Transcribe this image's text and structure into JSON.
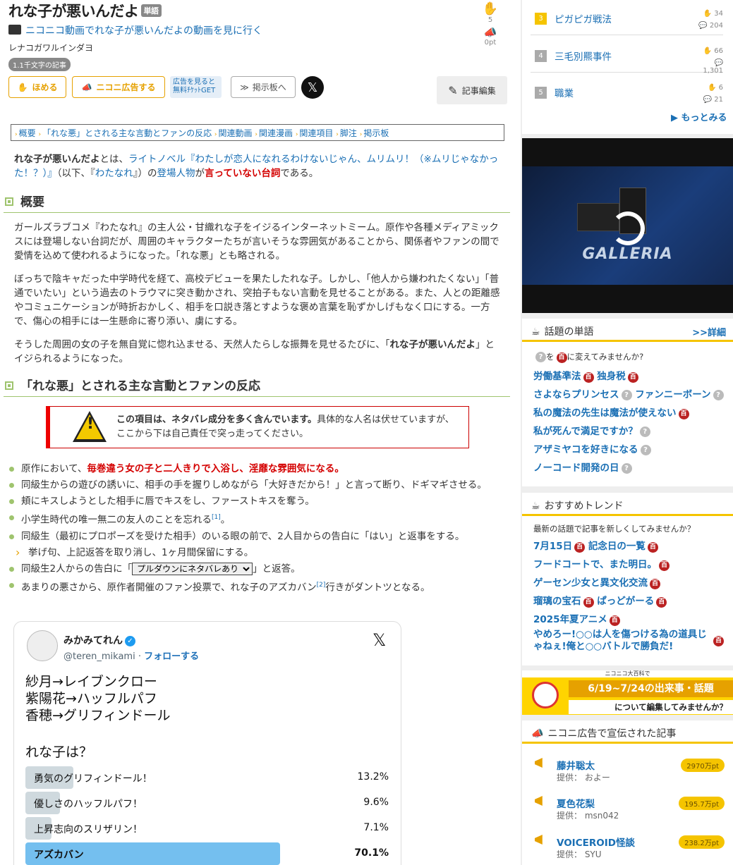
{
  "article": {
    "title": "れな子が悪いんだよ",
    "type_tag": "単語",
    "video_link": "ニコニコ動画でれな子が悪いんだよの動画を見に行く",
    "reading": "レナコガワルインダヨ",
    "char_count": "1.1千文字の記事",
    "claps": "5",
    "pt": "0pt"
  },
  "buttons": {
    "homeru": "ほめる",
    "ad": "ニコニ広告する",
    "ticket": "広告を見ると無料ﾁｹｯﾄGET",
    "bbs": "掲示板へ",
    "x": "𝕏",
    "edit": "記事編集"
  },
  "toc": [
    "概要",
    "「れな悪」とされる主な言動とファンの反応",
    "関連動画",
    "関連漫画",
    "関連項目",
    "脚注",
    "掲示板"
  ],
  "intro": {
    "a": "れな子が悪いんだよ",
    "b": "とは、",
    "c": "ライトノベル『わたしが恋人になれるわけないじゃん、ムリムリ！（※ムリじゃなかった！？）』",
    "d": "（以下、『",
    "e": "わたなれ",
    "f": "』）の",
    "g": "登場人物",
    "h": "が",
    "i": "言っていない台詞",
    "j": "である。"
  },
  "section1": {
    "title": "概要",
    "p1": "ガールズラブコメ『わたなれ』の主人公・甘織れな子をイジるインターネットミーム。原作や各種メディアミックスには登場しない台詞だが、周囲のキャラクターたちが言いそうな雰囲気があることから、関係者やファンの間で愛情を込めて使われるようになった。「れな悪」とも略される。",
    "p2": "ぼっちで陰キャだった中学時代を経て、高校デビューを果たしたれな子。しかし、「他人から嫌われたくない」「普通でいたい」という過去のトラウマに突き動かされ、突拍子もない言動を見せることがある。また、人との距離感やコミュニケーションが時折おかしく、相手を口説き落とすような褒め言葉を恥ずかしげもなく口にする。一方で、傷心の相手には一生懸命に寄り添い、虜にする。",
    "p3a": "そうした周囲の女の子を無自覚に惚れ込ませる、天然人たらしな振舞を見せるたびに、「",
    "p3b": "れな子が悪いんだよ",
    "p3c": "」とイジられるようになった。"
  },
  "section2": {
    "title": "「れな悪」とされる主な言動とファンの反応",
    "warn_bold": "この項目は、ネタバレ成分を多く含んでいます。",
    "warn_rest": "具体的な人名は伏せていますが、ここから下は自己責任で突っ走ってください。",
    "items": [
      {
        "a": "原作において、",
        "b": "毎巻違う女の子と二人きりで入浴し、淫靡な雰囲気になる。"
      },
      {
        "a": "同級生からの遊びの誘いに、相手の手を握りしめながら「大好きだから！」と言って断り、ドギマギさせる。"
      },
      {
        "a": "頬にキスしようとした相手に唇でキスをし、ファーストキスを奪う。"
      },
      {
        "a": "小学生時代の唯一無二の友人のことを忘れる",
        "sup": "[1]",
        "b": "。"
      },
      {
        "a": "同級生（最初にプロポーズを受けた相手）のいる眼の前で、2人目からの告白に「はい」と返事をする。"
      },
      {
        "a": "挙げ句、上記返答を取り消し、1ヶ月間保留にする。"
      },
      {
        "a": "同級生2人からの告白に「",
        "sel": "プルダウンにネタバレあり",
        "b": "」と返答。"
      },
      {
        "a": "あまりの悪さから、原作者開催のファン投票で、れな子のアズカバン",
        "sup": "[2]",
        "b": "行きがダントツとなる。"
      }
    ]
  },
  "tweet": {
    "name": "みかみてれん",
    "handle": "@teren_mikami · ",
    "follow": "フォローする",
    "body": "紗月→レイブンクロー\n紫陽花→ハッフルパフ\n香穂→グリフィンドール",
    "question": "れな子は？",
    "poll": [
      {
        "label": "勇気のグリフィンドール！",
        "pct": "13.2%",
        "value": 13.2
      },
      {
        "label": "優しさのハッフルパフ！",
        "pct": "9.6%",
        "value": 9.6
      },
      {
        "label": "上昇志向のスリザリン！",
        "pct": "7.1%",
        "value": 7.1
      },
      {
        "label": "アズカバン",
        "pct": "70.1%",
        "value": 70.1
      }
    ]
  },
  "sidebar": {
    "ranking": [
      {
        "num": "3",
        "title": "ピガピガ戦法",
        "claps": "34",
        "comments": "204"
      },
      {
        "num": "4",
        "title": "三毛別羆事件",
        "claps": "66",
        "comments": "1,301"
      },
      {
        "num": "5",
        "title": "職業",
        "claps": "6",
        "comments": "21"
      }
    ],
    "more": "▶ もっとみる",
    "video_logo": "GALLERIA",
    "topic": {
      "title": "話題の単語",
      "detail": ">>詳細",
      "hint_a": "を",
      "hint_b": "に変えてみませんか?",
      "rows": [
        [
          "労働基準法",
          "独身税"
        ],
        [
          "さよならプリンセス",
          "ファンニーボーン"
        ],
        [
          "私の魔法の先生は魔法が使えない"
        ],
        [
          "私が死んで満足ですか？"
        ],
        [
          "アザミヤコを好きになる"
        ],
        [
          "ノーコード開発の日"
        ]
      ]
    },
    "trend": {
      "title": "おすすめトレンド",
      "hint": "最新の話題で記事を新しくしてみませんか？",
      "rows": [
        [
          "7月15日",
          "記念日の一覧"
        ],
        [
          "フードコートで、また明日。"
        ],
        [
          "ゲーセン少女と異文化交流"
        ],
        [
          "瑠璃の宝石",
          "ぱっどがーる"
        ],
        [
          "2025年夏アニメ"
        ],
        [
          "やめろー!○○は人を傷つける為の道具じゃねぇ!俺と○○バトルで勝負だ!"
        ]
      ]
    },
    "banner": {
      "top": "ニコニコ大百科で",
      "main": "6/19~7/24の出来事・話題",
      "sub": "について編集してみませんか？"
    },
    "ads": {
      "title": "ニコニ広告で宣伝された記事",
      "items": [
        {
          "title": "藤井聡太",
          "by": "提供： およー",
          "pt": "2970万pt"
        },
        {
          "title": "夏色花梨",
          "by": "提供： msn042",
          "pt": "195.7万pt"
        },
        {
          "title": "VOICEROID怪談",
          "by": "提供： SYU",
          "pt": "238.2万pt"
        }
      ]
    },
    "icons": {
      "hy": "百",
      "qm": "?"
    }
  },
  "colors": {
    "accent": "#e6a100",
    "link": "#1a6fb4",
    "heading_line": "#9fc46e",
    "warn": "#d40000",
    "poll_win": "#74bfef"
  }
}
